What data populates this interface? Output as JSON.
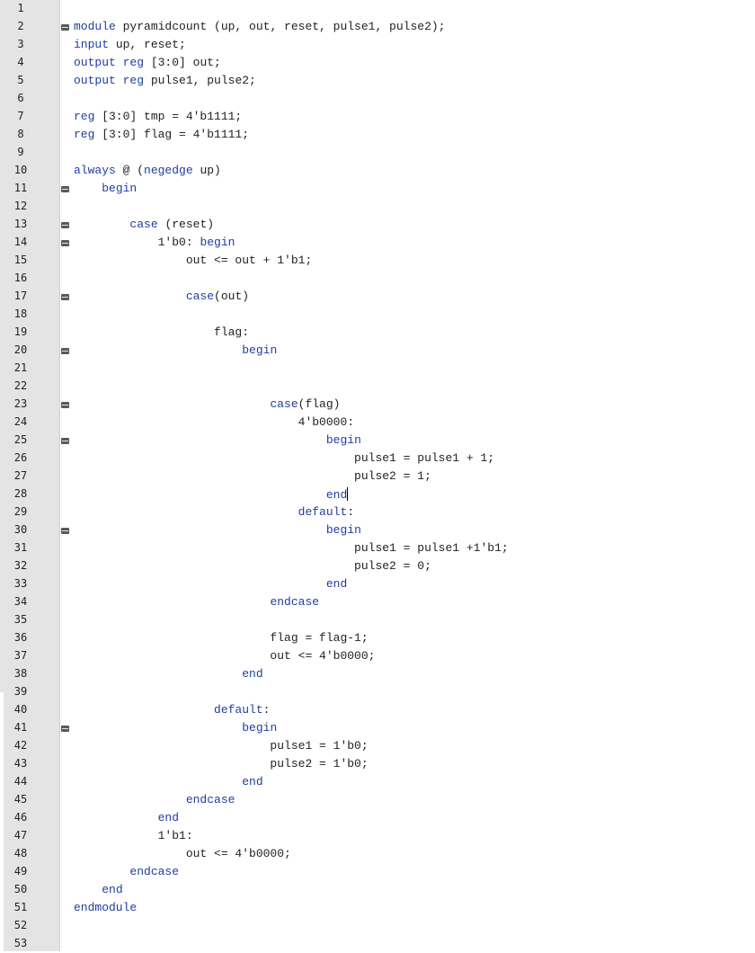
{
  "editor": {
    "colors": {
      "keyword": "#1f3da3",
      "text": "#222222",
      "gutter": "#e4e4e4",
      "fold_marker": "#5a5a5a"
    },
    "caret_line": 28,
    "lines": [
      {
        "n": "1",
        "fold": false,
        "t": []
      },
      {
        "n": "2",
        "fold": true,
        "t": [
          {
            "s": "module",
            "k": 1
          },
          {
            "s": " pyramidcount (up, out, reset, pulse1, pulse2);",
            "k": 0
          }
        ]
      },
      {
        "n": "3",
        "fold": false,
        "t": [
          {
            "s": "input",
            "k": 1
          },
          {
            "s": " up, reset;",
            "k": 0
          }
        ]
      },
      {
        "n": "4",
        "fold": false,
        "t": [
          {
            "s": "output",
            "k": 1
          },
          {
            "s": " ",
            "k": 0
          },
          {
            "s": "reg",
            "k": 1
          },
          {
            "s": " [3:0] out;",
            "k": 0
          }
        ]
      },
      {
        "n": "5",
        "fold": false,
        "t": [
          {
            "s": "output",
            "k": 1
          },
          {
            "s": " ",
            "k": 0
          },
          {
            "s": "reg",
            "k": 1
          },
          {
            "s": " pulse1, pulse2;",
            "k": 0
          }
        ]
      },
      {
        "n": "6",
        "fold": false,
        "t": []
      },
      {
        "n": "7",
        "fold": false,
        "t": [
          {
            "s": "reg",
            "k": 1
          },
          {
            "s": " [3:0] tmp = 4'b1111;",
            "k": 0
          }
        ]
      },
      {
        "n": "8",
        "fold": false,
        "t": [
          {
            "s": "reg",
            "k": 1
          },
          {
            "s": " [3:0] flag = 4'b1111;",
            "k": 0
          }
        ]
      },
      {
        "n": "9",
        "fold": false,
        "t": []
      },
      {
        "n": "10",
        "fold": false,
        "t": [
          {
            "s": "always",
            "k": 1
          },
          {
            "s": " @ (",
            "k": 0
          },
          {
            "s": "negedge",
            "k": 1
          },
          {
            "s": " up)",
            "k": 0
          }
        ]
      },
      {
        "n": "11",
        "fold": true,
        "t": [
          {
            "s": "    ",
            "k": 0
          },
          {
            "s": "begin",
            "k": 1
          }
        ]
      },
      {
        "n": "12",
        "fold": false,
        "t": []
      },
      {
        "n": "13",
        "fold": true,
        "t": [
          {
            "s": "        ",
            "k": 0
          },
          {
            "s": "case",
            "k": 1
          },
          {
            "s": " (reset)",
            "k": 0
          }
        ]
      },
      {
        "n": "14",
        "fold": true,
        "t": [
          {
            "s": "            1'b0: ",
            "k": 0
          },
          {
            "s": "begin",
            "k": 1
          }
        ]
      },
      {
        "n": "15",
        "fold": false,
        "t": [
          {
            "s": "                out <= out + 1'b1;",
            "k": 0
          }
        ]
      },
      {
        "n": "16",
        "fold": false,
        "t": []
      },
      {
        "n": "17",
        "fold": true,
        "t": [
          {
            "s": "                ",
            "k": 0
          },
          {
            "s": "case",
            "k": 1
          },
          {
            "s": "(out)",
            "k": 0
          }
        ]
      },
      {
        "n": "18",
        "fold": false,
        "t": []
      },
      {
        "n": "19",
        "fold": false,
        "t": [
          {
            "s": "                    flag:",
            "k": 0
          }
        ]
      },
      {
        "n": "20",
        "fold": true,
        "t": [
          {
            "s": "                        ",
            "k": 0
          },
          {
            "s": "begin",
            "k": 1
          }
        ]
      },
      {
        "n": "21",
        "fold": false,
        "t": []
      },
      {
        "n": "22",
        "fold": false,
        "t": []
      },
      {
        "n": "23",
        "fold": true,
        "t": [
          {
            "s": "                            ",
            "k": 0
          },
          {
            "s": "case",
            "k": 1
          },
          {
            "s": "(flag)",
            "k": 0
          }
        ]
      },
      {
        "n": "24",
        "fold": false,
        "t": [
          {
            "s": "                                4'b0000:",
            "k": 0
          }
        ]
      },
      {
        "n": "25",
        "fold": true,
        "t": [
          {
            "s": "                                    ",
            "k": 0
          },
          {
            "s": "begin",
            "k": 1
          }
        ]
      },
      {
        "n": "26",
        "fold": false,
        "t": [
          {
            "s": "                                        pulse1 = pulse1 + 1;",
            "k": 0
          }
        ]
      },
      {
        "n": "27",
        "fold": false,
        "t": [
          {
            "s": "                                        pulse2 = 1;",
            "k": 0
          }
        ]
      },
      {
        "n": "28",
        "fold": false,
        "t": [
          {
            "s": "                                    ",
            "k": 0
          },
          {
            "s": "end",
            "k": 1
          }
        ]
      },
      {
        "n": "29",
        "fold": false,
        "t": [
          {
            "s": "                                ",
            "k": 0
          },
          {
            "s": "default",
            "k": 1
          },
          {
            "s": ":",
            "k": 0
          }
        ]
      },
      {
        "n": "30",
        "fold": true,
        "t": [
          {
            "s": "                                    ",
            "k": 0
          },
          {
            "s": "begin",
            "k": 1
          }
        ]
      },
      {
        "n": "31",
        "fold": false,
        "t": [
          {
            "s": "                                        pulse1 = pulse1 +1'b1;",
            "k": 0
          }
        ]
      },
      {
        "n": "32",
        "fold": false,
        "t": [
          {
            "s": "                                        pulse2 = 0;",
            "k": 0
          }
        ]
      },
      {
        "n": "33",
        "fold": false,
        "t": [
          {
            "s": "                                    ",
            "k": 0
          },
          {
            "s": "end",
            "k": 1
          }
        ]
      },
      {
        "n": "34",
        "fold": false,
        "t": [
          {
            "s": "                            ",
            "k": 0
          },
          {
            "s": "endcase",
            "k": 1
          }
        ]
      },
      {
        "n": "35",
        "fold": false,
        "t": []
      },
      {
        "n": "36",
        "fold": false,
        "t": [
          {
            "s": "                            flag = flag-1;",
            "k": 0
          }
        ]
      },
      {
        "n": "37",
        "fold": false,
        "t": [
          {
            "s": "                            out <= 4'b0000;",
            "k": 0
          }
        ]
      },
      {
        "n": "38",
        "fold": false,
        "t": [
          {
            "s": "                        ",
            "k": 0
          },
          {
            "s": "end",
            "k": 1
          }
        ]
      },
      {
        "n": "39",
        "fold": false,
        "t": []
      },
      {
        "n": "40",
        "fold": false,
        "t": [
          {
            "s": "                    ",
            "k": 0
          },
          {
            "s": "default",
            "k": 1
          },
          {
            "s": ":",
            "k": 0
          }
        ]
      },
      {
        "n": "41",
        "fold": true,
        "t": [
          {
            "s": "                        ",
            "k": 0
          },
          {
            "s": "begin",
            "k": 1
          }
        ]
      },
      {
        "n": "42",
        "fold": false,
        "t": [
          {
            "s": "                            pulse1 = 1'b0;",
            "k": 0
          }
        ]
      },
      {
        "n": "43",
        "fold": false,
        "t": [
          {
            "s": "                            pulse2 = 1'b0;",
            "k": 0
          }
        ]
      },
      {
        "n": "44",
        "fold": false,
        "t": [
          {
            "s": "                        ",
            "k": 0
          },
          {
            "s": "end",
            "k": 1
          }
        ]
      },
      {
        "n": "45",
        "fold": false,
        "t": [
          {
            "s": "                ",
            "k": 0
          },
          {
            "s": "endcase",
            "k": 1
          }
        ]
      },
      {
        "n": "46",
        "fold": false,
        "t": [
          {
            "s": "            ",
            "k": 0
          },
          {
            "s": "end",
            "k": 1
          }
        ]
      },
      {
        "n": "47",
        "fold": false,
        "t": [
          {
            "s": "            1'b1:",
            "k": 0
          }
        ]
      },
      {
        "n": "48",
        "fold": false,
        "t": [
          {
            "s": "                out <= 4'b0000;",
            "k": 0
          }
        ]
      },
      {
        "n": "49",
        "fold": false,
        "t": [
          {
            "s": "        ",
            "k": 0
          },
          {
            "s": "endcase",
            "k": 1
          }
        ]
      },
      {
        "n": "50",
        "fold": false,
        "t": [
          {
            "s": "    ",
            "k": 0
          },
          {
            "s": "end",
            "k": 1
          }
        ]
      },
      {
        "n": "51",
        "fold": false,
        "t": [
          {
            "s": "endmodule",
            "k": 1
          }
        ]
      },
      {
        "n": "52",
        "fold": false,
        "t": []
      },
      {
        "n": "53",
        "fold": false,
        "t": []
      }
    ]
  }
}
